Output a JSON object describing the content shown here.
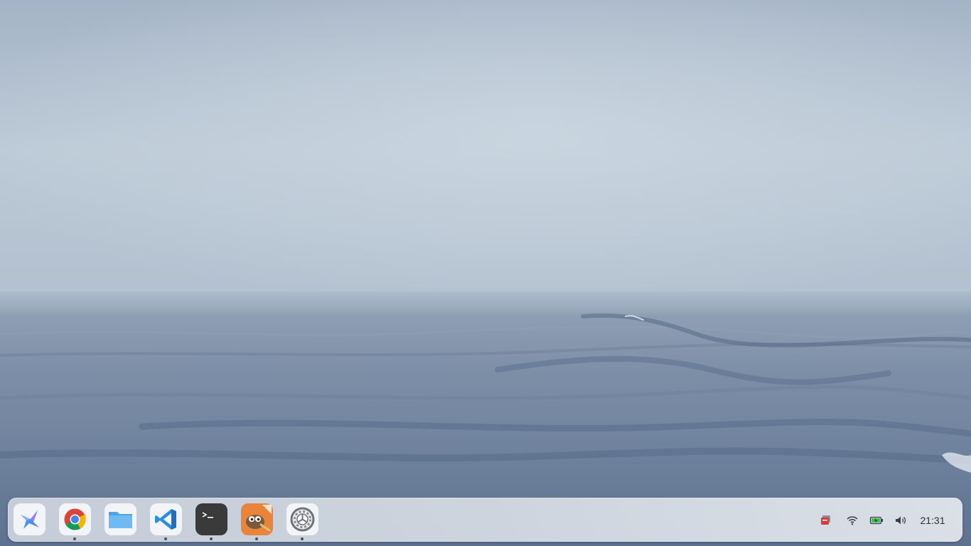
{
  "dock": {
    "apps": [
      {
        "name": "launcher",
        "icon": "launcher-icon",
        "running": false
      },
      {
        "name": "chrome",
        "icon": "chrome-icon",
        "running": true
      },
      {
        "name": "files",
        "icon": "folder-icon",
        "running": false
      },
      {
        "name": "vscode",
        "icon": "vscode-icon",
        "running": true
      },
      {
        "name": "terminal",
        "icon": "terminal-icon",
        "running": true
      },
      {
        "name": "gimp",
        "icon": "gimp-icon",
        "running": true
      },
      {
        "name": "settings",
        "icon": "gear-icon",
        "running": true
      }
    ]
  },
  "tray": {
    "icons": [
      "notification-icon",
      "wifi-icon",
      "battery-icon",
      "volume-icon"
    ],
    "clock": "21:31"
  },
  "colors": {
    "sky": "#c2cfdb",
    "sea": "#6f829c",
    "dock": "#d4dae3",
    "terminal": "#3a3a3a",
    "gimp": "#e8853a",
    "vscode": "#2a8de2",
    "battery_fill": "#3fbf4f"
  }
}
